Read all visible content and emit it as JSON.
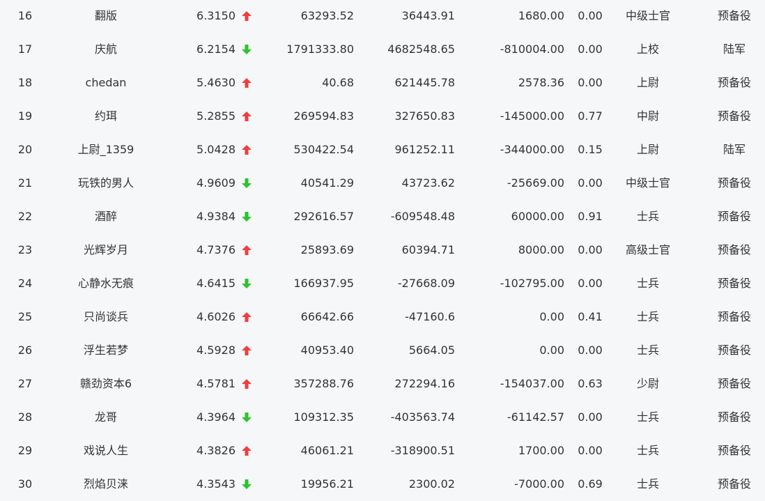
{
  "colors": {
    "up": "#f03e3e",
    "down": "#2bc42b",
    "text": "#333333",
    "background": "#f6f7f9"
  },
  "rows": [
    {
      "rank": "16",
      "name": "翻版",
      "score": "6.3150",
      "trend": "up",
      "v1": "63293.52",
      "v2": "36443.91",
      "v3": "1680.00",
      "v4": "0.00",
      "title": "中级士官",
      "category": "预备役"
    },
    {
      "rank": "17",
      "name": "庆航",
      "score": "6.2154",
      "trend": "down",
      "v1": "1791333.80",
      "v2": "4682548.65",
      "v3": "-810004.00",
      "v4": "0.00",
      "title": "上校",
      "category": "陆军"
    },
    {
      "rank": "18",
      "name": "chedan",
      "score": "5.4630",
      "trend": "up",
      "v1": "40.68",
      "v2": "621445.78",
      "v3": "2578.36",
      "v4": "0.00",
      "title": "上尉",
      "category": "预备役"
    },
    {
      "rank": "19",
      "name": "约珥",
      "score": "5.2855",
      "trend": "up",
      "v1": "269594.83",
      "v2": "327650.83",
      "v3": "-145000.00",
      "v4": "0.77",
      "title": "中尉",
      "category": "预备役"
    },
    {
      "rank": "20",
      "name": "上尉_1359",
      "score": "5.0428",
      "trend": "up",
      "v1": "530422.54",
      "v2": "961252.11",
      "v3": "-344000.00",
      "v4": "0.15",
      "title": "上尉",
      "category": "陆军"
    },
    {
      "rank": "21",
      "name": "玩铁的男人",
      "score": "4.9609",
      "trend": "down",
      "v1": "40541.29",
      "v2": "43723.62",
      "v3": "-25669.00",
      "v4": "0.00",
      "title": "中级士官",
      "category": "预备役"
    },
    {
      "rank": "22",
      "name": "酒醉",
      "score": "4.9384",
      "trend": "down",
      "v1": "292616.57",
      "v2": "-609548.48",
      "v3": "60000.00",
      "v4": "0.91",
      "title": "士兵",
      "category": "预备役"
    },
    {
      "rank": "23",
      "name": "光辉岁月",
      "score": "4.7376",
      "trend": "up",
      "v1": "25893.69",
      "v2": "60394.71",
      "v3": "8000.00",
      "v4": "0.00",
      "title": "高级士官",
      "category": "预备役"
    },
    {
      "rank": "24",
      "name": "心静水无痕",
      "score": "4.6415",
      "trend": "down",
      "v1": "166937.95",
      "v2": "-27668.09",
      "v3": "-102795.00",
      "v4": "0.00",
      "title": "士兵",
      "category": "预备役"
    },
    {
      "rank": "25",
      "name": "只尚谈兵",
      "score": "4.6026",
      "trend": "up",
      "v1": "66642.66",
      "v2": "-47160.6",
      "v3": "0.00",
      "v4": "0.41",
      "title": "士兵",
      "category": "预备役"
    },
    {
      "rank": "26",
      "name": "浮生若梦",
      "score": "4.5928",
      "trend": "up",
      "v1": "40953.40",
      "v2": "5664.05",
      "v3": "0.00",
      "v4": "0.00",
      "title": "士兵",
      "category": "预备役"
    },
    {
      "rank": "27",
      "name": "赣劲资本6",
      "score": "4.5781",
      "trend": "up",
      "v1": "357288.76",
      "v2": "272294.16",
      "v3": "-154037.00",
      "v4": "0.63",
      "title": "少尉",
      "category": "预备役"
    },
    {
      "rank": "28",
      "name": "龙哥",
      "score": "4.3964",
      "trend": "down",
      "v1": "109312.35",
      "v2": "-403563.74",
      "v3": "-61142.57",
      "v4": "0.00",
      "title": "士兵",
      "category": "预备役"
    },
    {
      "rank": "29",
      "name": "戏说人生",
      "score": "4.3826",
      "trend": "up",
      "v1": "46061.21",
      "v2": "-318900.51",
      "v3": "1700.00",
      "v4": "0.00",
      "title": "士兵",
      "category": "预备役"
    },
    {
      "rank": "30",
      "name": "烈焰贝涞",
      "score": "4.3543",
      "trend": "down",
      "v1": "19956.21",
      "v2": "2300.02",
      "v3": "-7000.00",
      "v4": "0.69",
      "title": "士兵",
      "category": "预备役"
    }
  ]
}
